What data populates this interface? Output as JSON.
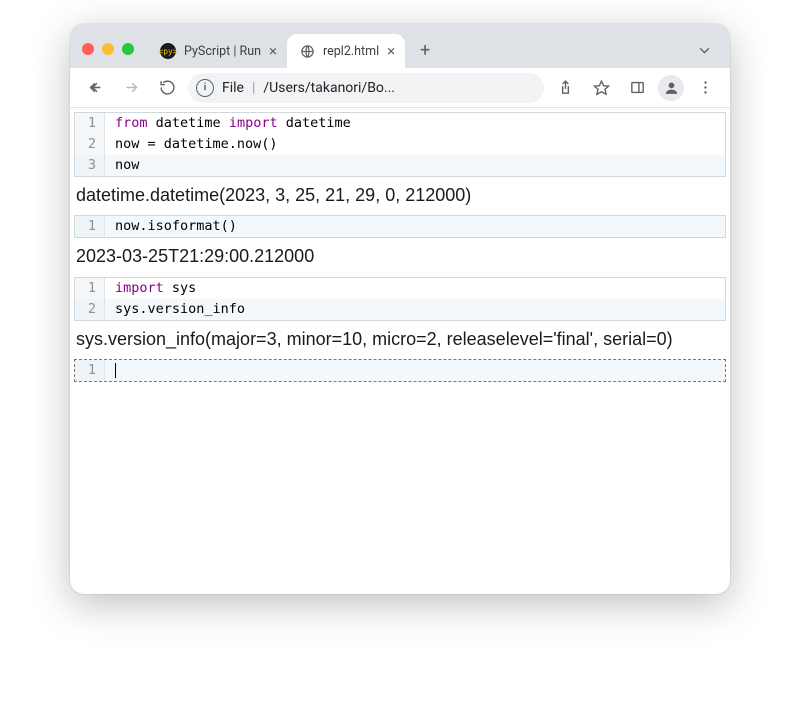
{
  "window": {
    "traffic": [
      "close",
      "minimize",
      "zoom"
    ]
  },
  "tabs": [
    {
      "favicon": "<py>",
      "title": "PyScript | Run",
      "active": false
    },
    {
      "favicon": "file",
      "title": "repl2.html",
      "active": true
    }
  ],
  "toolbar": {
    "omnibox": {
      "scheme_label": "File",
      "path": "/Users/takanori/Bo..."
    }
  },
  "cells": [
    {
      "lines": [
        {
          "n": "1",
          "tokens": [
            [
              "kw",
              "from"
            ],
            [
              " ",
              " "
            ],
            [
              "",
              "datetime"
            ],
            [
              " ",
              " "
            ],
            [
              "kw",
              "import"
            ],
            [
              " ",
              " "
            ],
            [
              "",
              "datetime"
            ]
          ]
        },
        {
          "n": "2",
          "tokens": [
            [
              "",
              "now = datetime.now()"
            ]
          ]
        },
        {
          "n": "3",
          "hl": true,
          "tokens": [
            [
              "",
              "now"
            ]
          ]
        }
      ],
      "output": "datetime.datetime(2023, 3, 25, 21, 29, 0, 212000)"
    },
    {
      "lines": [
        {
          "n": "1",
          "hl": true,
          "tokens": [
            [
              "",
              "now.isoformat()"
            ]
          ]
        }
      ],
      "output": "2023-03-25T21:29:00.212000"
    },
    {
      "lines": [
        {
          "n": "1",
          "tokens": [
            [
              "kw",
              "import"
            ],
            [
              " ",
              " "
            ],
            [
              "",
              "sys"
            ]
          ]
        },
        {
          "n": "2",
          "hl": true,
          "tokens": [
            [
              "",
              "sys.version_info"
            ]
          ]
        }
      ],
      "output": "sys.version_info(major=3, minor=10, micro=2, releaselevel='final', serial=0)"
    },
    {
      "active": true,
      "lines": [
        {
          "n": "1",
          "hl": true,
          "tokens": [],
          "caret": true
        }
      ]
    }
  ]
}
